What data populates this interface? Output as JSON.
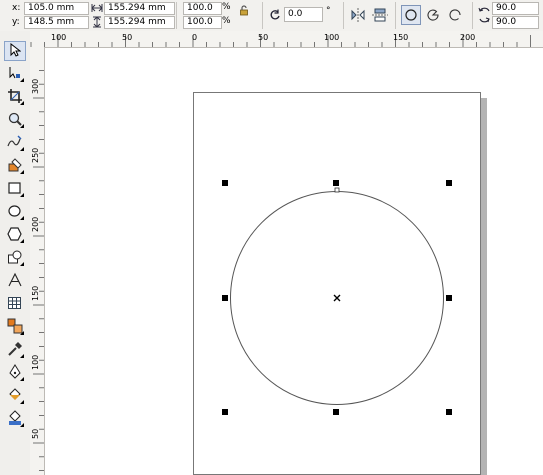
{
  "property_bar": {
    "x_label": "x:",
    "x_value": "105.0 mm",
    "y_label": "y:",
    "y_value": "148.5 mm",
    "width_value": "155.294 mm",
    "height_value": "155.294 mm",
    "scale_w": "100.0",
    "scale_h": "100.0",
    "percent": "%",
    "rotation_value": "0.0",
    "degree": "°",
    "start_angle": "90.0",
    "end_angle": "90.0"
  },
  "rulers": {
    "horizontal_labels": [
      "100",
      "50",
      "0",
      "50",
      "100",
      "150",
      "200"
    ],
    "vertical_labels": [
      "300",
      "250",
      "200",
      "150",
      "100",
      "50"
    ]
  },
  "tools": [
    {
      "name": "pick-tool",
      "icon": "arrow-pointer-icon"
    },
    {
      "name": "shape-tool",
      "icon": "shape-node-icon"
    },
    {
      "name": "crop-tool",
      "icon": "crop-icon"
    },
    {
      "name": "zoom-tool",
      "icon": "magnifier-icon"
    },
    {
      "name": "freehand-tool",
      "icon": "freehand-icon"
    },
    {
      "name": "smart-fill-tool",
      "icon": "smart-fill-icon"
    },
    {
      "name": "rectangle-tool",
      "icon": "rectangle-icon"
    },
    {
      "name": "ellipse-tool",
      "icon": "ellipse-icon"
    },
    {
      "name": "polygon-tool",
      "icon": "polygon-icon"
    },
    {
      "name": "basic-shapes-tool",
      "icon": "basic-shapes-icon"
    },
    {
      "name": "text-tool",
      "icon": "text-A-icon"
    },
    {
      "name": "table-tool",
      "icon": "table-icon"
    },
    {
      "name": "interactive-tool",
      "icon": "blend-icon"
    },
    {
      "name": "eyedropper-tool",
      "icon": "eyedropper-icon"
    },
    {
      "name": "outline-tool",
      "icon": "pen-nib-icon"
    },
    {
      "name": "fill-tool",
      "icon": "paint-bucket-icon"
    },
    {
      "name": "interactive-fill-tool",
      "icon": "interactive-fill-icon"
    }
  ]
}
